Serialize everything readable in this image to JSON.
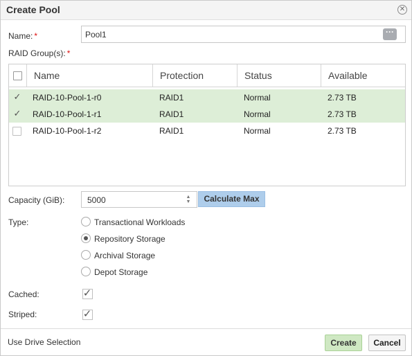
{
  "dialog": {
    "title": "Create Pool",
    "close_icon": "close-circle-icon"
  },
  "form": {
    "name_label": "Name:",
    "required_mark": "*",
    "name_value": "Pool1",
    "ellipsis_label": "···",
    "raid_groups_label": "RAID Group(s):",
    "capacity_label": "Capacity (GiB):",
    "capacity_value": "5000",
    "calculate_max_label": "Calculate Max",
    "type_label": "Type:",
    "type_options": [
      "Transactional Workloads",
      "Repository Storage",
      "Archival Storage",
      "Depot Storage"
    ],
    "type_selected": "Repository Storage",
    "cached_label": "Cached:",
    "cached": true,
    "striped_label": "Striped:",
    "striped": true
  },
  "grid": {
    "columns": [
      "Name",
      "Protection",
      "Status",
      "Available"
    ],
    "rows": [
      {
        "name": "RAID-10-Pool-1-r0",
        "protection": "RAID1",
        "status": "Normal",
        "available": "2.73 TB",
        "selected": true
      },
      {
        "name": "RAID-10-Pool-1-r1",
        "protection": "RAID1",
        "status": "Normal",
        "available": "2.73 TB",
        "selected": true
      },
      {
        "name": "RAID-10-Pool-1-r2",
        "protection": "RAID1",
        "status": "Normal",
        "available": "2.73 TB",
        "selected": false
      }
    ]
  },
  "footer": {
    "drive_selection_label": "Use Drive Selection",
    "create_label": "Create",
    "cancel_label": "Cancel"
  },
  "colors": {
    "selected_row": "#ddeed7",
    "create_button": "#cfe8c3",
    "calculate_button": "#aecdeb",
    "required": "#dd1111"
  }
}
